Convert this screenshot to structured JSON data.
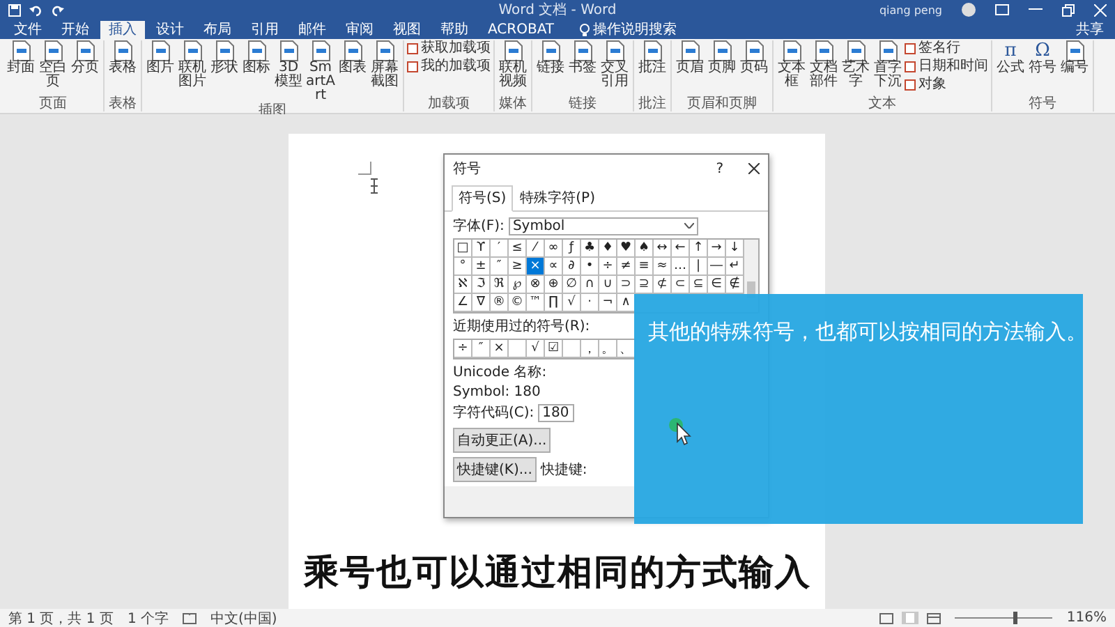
{
  "window": {
    "title": "Word 文档 - Word",
    "user": "qiang peng"
  },
  "tabs": [
    {
      "label": "文件",
      "selected": false
    },
    {
      "label": "开始",
      "selected": false
    },
    {
      "label": "插入",
      "selected": true
    },
    {
      "label": "设计",
      "selected": false
    },
    {
      "label": "布局",
      "selected": false
    },
    {
      "label": "引用",
      "selected": false
    },
    {
      "label": "邮件",
      "selected": false
    },
    {
      "label": "审阅",
      "selected": false
    },
    {
      "label": "视图",
      "selected": false
    },
    {
      "label": "帮助",
      "selected": false
    },
    {
      "label": "ACROBAT",
      "selected": false
    }
  ],
  "tell_me": "操作说明搜索",
  "share": "共享",
  "ribbon": [
    {
      "label": "页面",
      "buttons": [
        {
          "label": "封面"
        },
        {
          "label": "空白页"
        },
        {
          "label": "分页"
        }
      ]
    },
    {
      "label": "表格",
      "buttons": [
        {
          "label": "表格"
        }
      ]
    },
    {
      "label": "插图",
      "buttons": [
        {
          "label": "图片"
        },
        {
          "label": "联机图片"
        },
        {
          "label": "形状"
        },
        {
          "label": "图标"
        },
        {
          "label": "3D模型"
        },
        {
          "label": "SmartArt"
        },
        {
          "label": "图表"
        },
        {
          "label": "屏幕截图"
        }
      ]
    },
    {
      "label": "加载项",
      "small_buttons": [
        {
          "label": "获取加载项"
        },
        {
          "label": "我的加载项"
        }
      ]
    },
    {
      "label": "媒体",
      "buttons": [
        {
          "label": "联机视频"
        }
      ]
    },
    {
      "label": "链接",
      "buttons": [
        {
          "label": "链接"
        },
        {
          "label": "书签"
        },
        {
          "label": "交叉引用"
        }
      ]
    },
    {
      "label": "批注",
      "buttons": [
        {
          "label": "批注"
        }
      ]
    },
    {
      "label": "页眉和页脚",
      "buttons": [
        {
          "label": "页眉"
        },
        {
          "label": "页脚"
        },
        {
          "label": "页码"
        }
      ]
    },
    {
      "label": "文本",
      "buttons": [
        {
          "label": "文本框"
        },
        {
          "label": "文档部件"
        },
        {
          "label": "艺术字"
        },
        {
          "label": "首字下沉"
        }
      ],
      "small_buttons": [
        {
          "label": "签名行"
        },
        {
          "label": "日期和时间"
        },
        {
          "label": "对象"
        }
      ]
    },
    {
      "label": "符号",
      "buttons": [
        {
          "label": "公式",
          "glyph": "π"
        },
        {
          "label": "符号",
          "glyph": "Ω"
        },
        {
          "label": "编号"
        }
      ]
    }
  ],
  "dialog": {
    "title": "符号",
    "help": "?",
    "tabs": [
      {
        "label": "符号(S)",
        "selected": true
      },
      {
        "label": "特殊字符(P)",
        "selected": false
      }
    ],
    "font_label": "字体(F):",
    "font_value": "Symbol",
    "symbols": [
      [
        {
          "char": "□",
          "selected": false
        },
        {
          "char": "ϒ",
          "selected": false
        },
        {
          "char": "′",
          "selected": false
        },
        {
          "char": "≤",
          "selected": false
        },
        {
          "char": "⁄",
          "selected": false
        },
        {
          "char": "∞",
          "selected": false
        },
        {
          "char": "ƒ",
          "selected": false
        },
        {
          "char": "♣",
          "selected": false
        },
        {
          "char": "♦",
          "selected": false
        },
        {
          "char": "♥",
          "selected": false
        },
        {
          "char": "♠",
          "selected": false
        },
        {
          "char": "↔",
          "selected": false
        },
        {
          "char": "←",
          "selected": false
        },
        {
          "char": "↑",
          "selected": false
        },
        {
          "char": "→",
          "selected": false
        },
        {
          "char": "↓",
          "selected": false
        }
      ],
      [
        {
          "char": "°",
          "selected": false
        },
        {
          "char": "±",
          "selected": false
        },
        {
          "char": "″",
          "selected": false
        },
        {
          "char": "≥",
          "selected": false
        },
        {
          "char": "×",
          "selected": true
        },
        {
          "char": "∝",
          "selected": false
        },
        {
          "char": "∂",
          "selected": false
        },
        {
          "char": "•",
          "selected": false
        },
        {
          "char": "÷",
          "selected": false
        },
        {
          "char": "≠",
          "selected": false
        },
        {
          "char": "≡",
          "selected": false
        },
        {
          "char": "≈",
          "selected": false
        },
        {
          "char": "…",
          "selected": false
        },
        {
          "char": "|",
          "selected": false
        },
        {
          "char": "―",
          "selected": false
        },
        {
          "char": "↵",
          "selected": false
        }
      ],
      [
        {
          "char": "ℵ",
          "selected": false
        },
        {
          "char": "ℑ",
          "selected": false
        },
        {
          "char": "ℜ",
          "selected": false
        },
        {
          "char": "℘",
          "selected": false
        },
        {
          "char": "⊗",
          "selected": false
        },
        {
          "char": "⊕",
          "selected": false
        },
        {
          "char": "∅",
          "selected": false
        },
        {
          "char": "∩",
          "selected": false
        },
        {
          "char": "∪",
          "selected": false
        },
        {
          "char": "⊃",
          "selected": false
        },
        {
          "char": "⊇",
          "selected": false
        },
        {
          "char": "⊄",
          "selected": false
        },
        {
          "char": "⊂",
          "selected": false
        },
        {
          "char": "⊆",
          "selected": false
        },
        {
          "char": "∈",
          "selected": false
        },
        {
          "char": "∉",
          "selected": false
        }
      ],
      [
        {
          "char": "∠",
          "selected": false
        },
        {
          "char": "∇",
          "selected": false
        },
        {
          "char": "®",
          "selected": false
        },
        {
          "char": "©",
          "selected": false
        },
        {
          "char": "™",
          "selected": false
        },
        {
          "char": "∏",
          "selected": false
        },
        {
          "char": "√",
          "selected": false
        },
        {
          "char": "⋅",
          "selected": false
        },
        {
          "char": "¬",
          "selected": false
        },
        {
          "char": "∧",
          "selected": false
        }
      ]
    ],
    "recent_label": "近期使用过的符号(R):",
    "recent": [
      {
        "kind": "symbol",
        "char": "÷"
      },
      {
        "kind": "symbol",
        "char": "″"
      },
      {
        "kind": "symbol",
        "char": "×"
      },
      {
        "kind": "empty"
      },
      {
        "kind": "symbol",
        "char": "√"
      },
      {
        "kind": "symbol",
        "char": "☑"
      },
      {
        "kind": "empty"
      },
      {
        "kind": "symbol",
        "char": "，"
      },
      {
        "kind": "symbol",
        "char": "。"
      },
      {
        "kind": "symbol",
        "char": "、"
      }
    ],
    "unicode_name_label": "Unicode 名称:",
    "unicode_name": "Symbol: 180",
    "char_code_label": "字符代码(C):",
    "char_code": "180",
    "buttons": [
      {
        "label": "自动更正(A)..."
      },
      {
        "label": "快捷键(K)..."
      }
    ],
    "shortcut_label": "快捷键:"
  },
  "overlay": {
    "text": "其他的特殊符号，也都可以按相同的方法输入。"
  },
  "caption": "乘号也可以通过相同的方式输入",
  "status_bar": {
    "page": "第 1 页，共 1 页",
    "words": "1 个字",
    "language": "中文(中国)",
    "zoom": "116%",
    "zoom_slider": {
      "level": 0.6
    }
  }
}
